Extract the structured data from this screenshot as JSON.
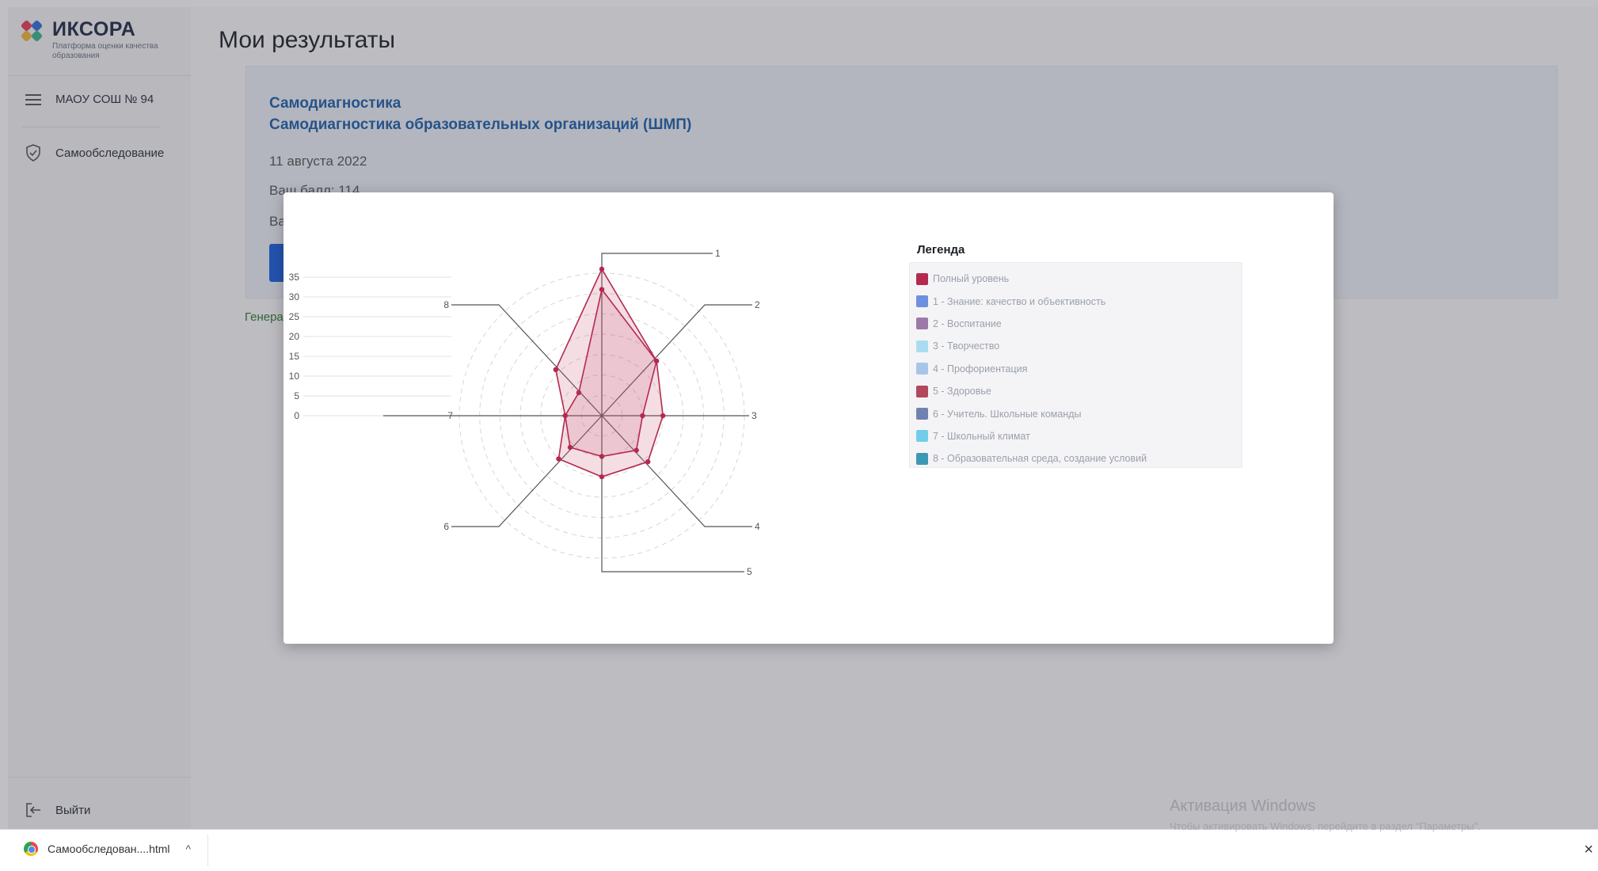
{
  "sidebar": {
    "logo_name": "ИКСОРА",
    "logo_subtitle": "Платформа оценки качества образования",
    "org_label": "МАОУ СОШ № 94",
    "nav_item": "Самообследование",
    "logout": "Выйти"
  },
  "main": {
    "title": "Мои результаты",
    "card": {
      "title1": "Самодиагностика",
      "title2": "Самодиагностика образовательных организаций (ШМП)",
      "date": "11 августа 2022",
      "score": "Ваш балл: 114",
      "second_line": "Ва"
    },
    "gen_link": "Генера"
  },
  "modal": {
    "legend_title": "Легенда",
    "legend": [
      {
        "label": "Полный уровень",
        "color": "#b5294f"
      },
      {
        "label": "1 - Знание: качество и объективность",
        "color": "#6f8fe0"
      },
      {
        "label": "2 - Воспитание",
        "color": "#9b7aa8"
      },
      {
        "label": "3 - Творчество",
        "color": "#a9dcef"
      },
      {
        "label": "4 - Профориентация",
        "color": "#a8c4e8"
      },
      {
        "label": "5 - Здоровье",
        "color": "#b2485c"
      },
      {
        "label": "6 - Учитель. Школьные команды",
        "color": "#7282b0"
      },
      {
        "label": "7 - Школьный климат",
        "color": "#72cdea"
      },
      {
        "label": "8 - Образовательная среда, создание условий",
        "color": "#3c98b3"
      }
    ]
  },
  "chart_data": {
    "type": "radar",
    "axis_labels": [
      "1",
      "2",
      "3",
      "4",
      "5",
      "6",
      "7",
      "8"
    ],
    "scale_ticks": [
      "0",
      "5",
      "10",
      "15",
      "20",
      "25",
      "30",
      "35"
    ],
    "rmax": 35,
    "series": [
      {
        "name": "Полный уровень",
        "values": [
          36,
          19,
          15,
          16,
          15,
          15,
          9,
          16
        ],
        "color": "#b5294f"
      },
      {
        "values": [
          31,
          19,
          10,
          12,
          10,
          11,
          9,
          8
        ],
        "color": "#b5294f"
      }
    ]
  },
  "taskbar": {
    "download_name": "Самообследован....html",
    "chevron": "^",
    "close": "×",
    "windows_activation": "Активация Windows",
    "windows_activation_sub": "Чтобы активировать Windows, перейдите в раздел \"Параметры\"."
  }
}
